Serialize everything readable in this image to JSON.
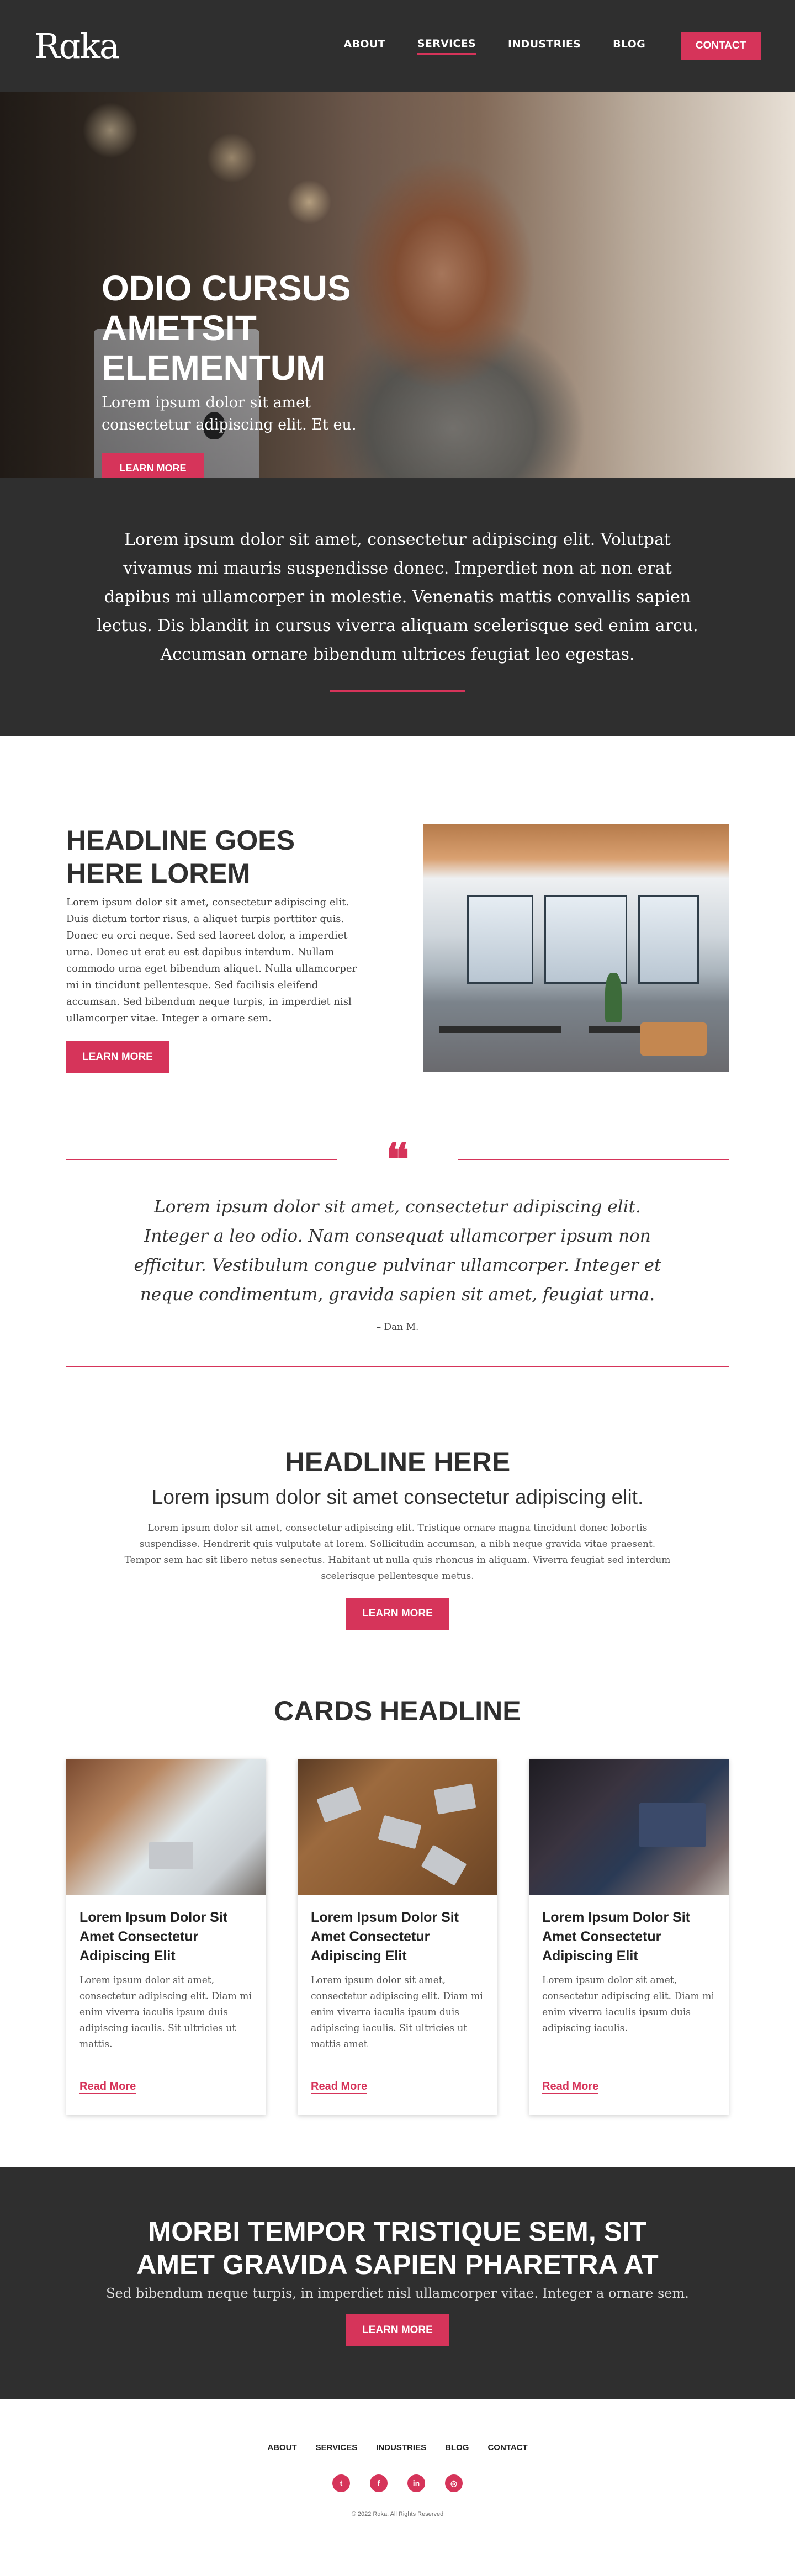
{
  "brand": {
    "logo": "Rɑka",
    "accent": "#d6345a",
    "dark": "#2f2f2f"
  },
  "nav": {
    "items": [
      {
        "label": "ABOUT"
      },
      {
        "label": "SERVICES"
      },
      {
        "label": "INDUSTRIES"
      },
      {
        "label": "BLOG"
      }
    ],
    "active": "SERVICES",
    "contact_label": "CONTACT"
  },
  "hero": {
    "title": "ODIO CURSUS AMETSIT ELEMENTUM",
    "subtitle": "Lorem ipsum dolor sit amet consectetur adipiscing elit. Et eu.",
    "button": "LEARN MORE"
  },
  "intro": {
    "text": "Lorem ipsum dolor sit amet, consectetur adipiscing elit. Volutpat vivamus mi mauris suspendisse donec. Imperdiet non at non erat dapibus mi ullamcorper in molestie. Venenatis mattis convallis sapien lectus. Dis blandit in cursus viverra aliquam scelerisque sed enim arcu. Accumsan ornare bibendum ultrices feugiat leo egestas."
  },
  "feature": {
    "title": "HEADLINE GOES HERE LOREM",
    "body": "Lorem ipsum dolor sit amet, consectetur adipiscing elit. Duis dictum tortor risus, a aliquet turpis porttitor quis. Donec eu orci neque. Sed sed laoreet dolor, a imperdiet urna. Donec ut erat eu est dapibus interdum. Nullam commodo urna eget bibendum aliquet. Nulla ullamcorper mi in tincidunt pellentesque. Sed facilisis eleifend accumsan. Sed bibendum neque turpis, in imperdiet nisl ullamcorper vitae. Integer a ornare sem.",
    "button": "LEARN MORE",
    "image_icon": "office-photo"
  },
  "quote": {
    "mark": "❝",
    "text": "Lorem ipsum dolor sit amet, consectetur adipiscing elit. Integer a leo odio. Nam consequat ullamcorper ipsum non efficitur. Vestibulum congue pulvinar ullamcorper. Integer et neque condimentum, gravida sapien sit amet, feugiat urna.",
    "author": "– Dan M."
  },
  "headline_section": {
    "title": "HEADLINE HERE",
    "subtitle": "Lorem ipsum dolor sit amet consectetur adipiscing elit.",
    "body": "Lorem ipsum dolor sit amet, consectetur adipiscing elit. Tristique ornare magna tincidunt donec lobortis suspendisse. Hendrerit quis vulputate at lorem. Sollicitudin accumsan, a nibh neque gravida vitae praesent. Tempor sem hac sit libero netus senectus. Habitant ut nulla quis rhoncus in aliquam. Viverra feugiat sed interdum scelerisque pellentesque metus.",
    "button": "LEARN MORE"
  },
  "cards_section": {
    "title": "CARDS HEADLINE",
    "cards": [
      {
        "title": "Lorem Ipsum Dolor Sit Amet Consectetur Adipiscing Elit",
        "text": "Lorem ipsum dolor sit amet, consectetur adipiscing elit. Diam mi enim viverra iaculis ipsum duis adipiscing iaculis. Sit ultricies ut mattis.",
        "link": "Read More"
      },
      {
        "title": "Lorem Ipsum Dolor Sit Amet Consectetur Adipiscing Elit",
        "text": "Lorem ipsum dolor sit amet, consectetur adipiscing elit. Diam mi enim viverra iaculis ipsum duis adipiscing iaculis. Sit ultricies ut mattis amet",
        "link": "Read More"
      },
      {
        "title": "Lorem Ipsum Dolor Sit Amet Consectetur Adipiscing Elit",
        "text": "Lorem ipsum dolor sit amet, consectetur adipiscing elit. Diam mi enim viverra iaculis ipsum duis adipiscing iaculis.",
        "link": "Read More"
      }
    ]
  },
  "cta": {
    "title": "MORBI TEMPOR TRISTIQUE SEM, SIT AMET GRAVIDA SAPIEN PHARETRA AT",
    "subtitle": "Sed bibendum neque turpis, in imperdiet nisl ullamcorper vitae. Integer a ornare sem.",
    "button": "LEARN MORE"
  },
  "footer": {
    "links": [
      "ABOUT",
      "SERVICES",
      "INDUSTRIES",
      "BLOG",
      "CONTACT"
    ],
    "socials": [
      {
        "icon": "twitter-icon",
        "glyph": "t"
      },
      {
        "icon": "facebook-icon",
        "glyph": "f"
      },
      {
        "icon": "linkedin-icon",
        "glyph": "in"
      },
      {
        "icon": "instagram-icon",
        "glyph": "◎"
      }
    ],
    "copyright": "© 2022 Rɑka. All Rights Reserved"
  }
}
